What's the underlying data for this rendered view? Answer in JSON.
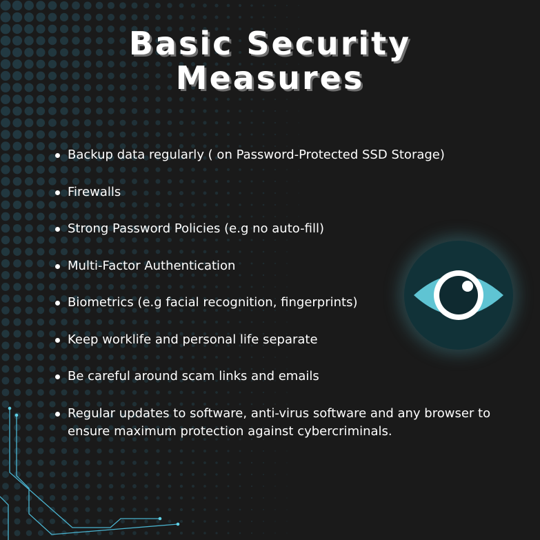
{
  "title_line1": "Basic Security",
  "title_line2": "Measures",
  "bullets": [
    "Backup data regularly ( on Password-Protected SSD Storage)",
    "Firewalls",
    "Strong Password Policies (e.g no auto-fill)",
    "Multi-Factor Authentication",
    "Biometrics (e.g facial recognition, fingerprints)",
    "Keep worklife and personal life separate",
    "Be careful around scam links and emails",
    "Regular updates to software, anti-virus software and any browser to ensure maximum protection against cybercriminals."
  ],
  "icons": {
    "eye": "eye-icon",
    "circuit": "circuit-lines"
  },
  "colors": {
    "background": "#1a1a1a",
    "dot": "#24404a",
    "eye_circle": "#113238",
    "eye_white": "#5fc4d3",
    "accent_line": "#4bb5d1",
    "text": "#ffffff"
  }
}
